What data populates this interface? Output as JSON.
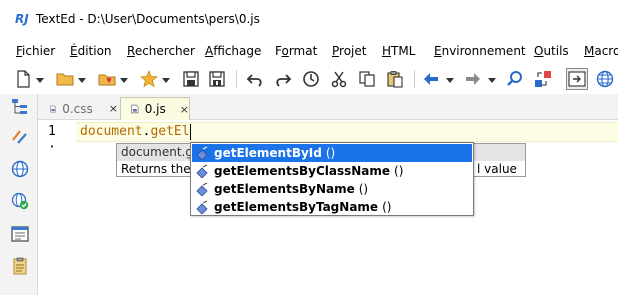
{
  "window": {
    "title": "TextEd - D:\\User\\Documents\\pers\\0.js"
  },
  "menu": [
    {
      "label": "Fichier",
      "accel": "F"
    },
    {
      "label": "Édition",
      "accel": "É"
    },
    {
      "label": "Rechercher",
      "accel": "R"
    },
    {
      "label": "Affichage",
      "accel": "A"
    },
    {
      "label": "Format",
      "accel": "o"
    },
    {
      "label": "Projet",
      "accel": "P"
    },
    {
      "label": "HTML",
      "accel": "H"
    },
    {
      "label": "Environnement",
      "accel": "E"
    },
    {
      "label": "Outils",
      "accel": "O"
    },
    {
      "label": "Macro",
      "accel": "M"
    }
  ],
  "toolbar": {
    "icons": [
      "new-file-icon",
      "open-folder-icon",
      "favorites-icon",
      "star-icon",
      "save-icon",
      "save-all-icon",
      "undo-icon",
      "redo-icon",
      "history-icon",
      "cut-icon",
      "copy-icon",
      "paste-icon",
      "back-arrow-icon",
      "forward-arrow-icon",
      "search-icon",
      "replace-icon",
      "view-toggle-icon",
      "globe-icon"
    ]
  },
  "tabs": [
    {
      "label": "0.css",
      "active": false,
      "close": "×"
    },
    {
      "label": "0.js",
      "active": true,
      "close": "×"
    }
  ],
  "editor": {
    "line_numbers": [
      "1",
      "·"
    ],
    "code_object": "document",
    "code_dot": ".",
    "code_method": "getEl"
  },
  "tooltip": {
    "signature": "document.ge",
    "description": "Returns the",
    "tail": "l value"
  },
  "autocomplete": [
    {
      "name": "getElementById",
      "parens": "()",
      "selected": true
    },
    {
      "name": "getElementsByClassName",
      "parens": "()",
      "selected": false
    },
    {
      "name": "getElementsByName",
      "parens": "()",
      "selected": false
    },
    {
      "name": "getElementsByTagName",
      "parens": "()",
      "selected": false
    }
  ],
  "colors": {
    "selection": "#1a73e8",
    "current_line": "#fdfde4",
    "code_identifier": "#b26b00"
  }
}
